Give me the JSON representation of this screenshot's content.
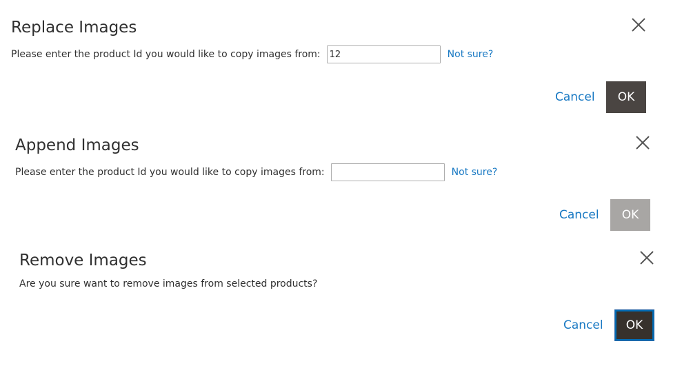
{
  "dialogs": [
    {
      "title": "Replace Images",
      "prompt_label": "Please enter the product Id you would like to copy images from:",
      "input_value": "12",
      "not_sure_link": "Not sure?",
      "cancel_label": "Cancel",
      "ok_label": "OK",
      "ok_state": "enabled"
    },
    {
      "title": "Append Images",
      "prompt_label": "Please enter the product Id you would like to copy images from:",
      "input_value": "",
      "not_sure_link": "Not sure?",
      "cancel_label": "Cancel",
      "ok_label": "OK",
      "ok_state": "disabled"
    },
    {
      "title": "Remove Images",
      "message": "Are you sure want to remove images from selected products?",
      "cancel_label": "Cancel",
      "ok_label": "OK",
      "ok_state": "focused"
    }
  ],
  "icons": {
    "close": "close-icon"
  },
  "colors": {
    "link": "#1979c3",
    "ok_enabled": "#4a4542",
    "ok_disabled": "#a8a6a4",
    "ok_focused": "#37312c",
    "text": "#303030"
  }
}
